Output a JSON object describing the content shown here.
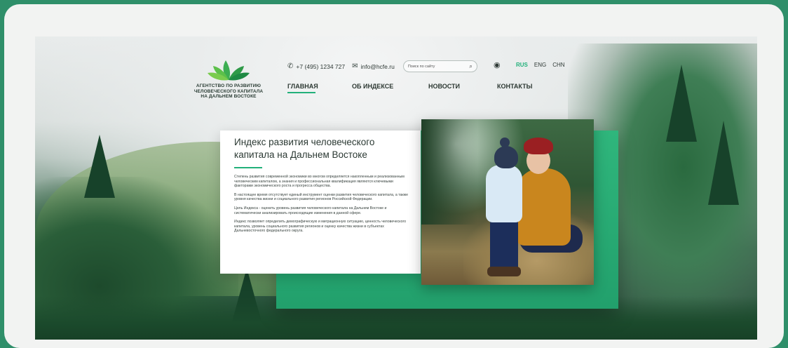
{
  "site": {
    "logo_text": "АГЕНТСТВО ПО РАЗВИТИЮ ЧЕЛОВЕЧЕСКОГО КАПИТАЛА НА ДАЛЬНЕМ ВОСТОКЕ"
  },
  "header": {
    "phone": "+7 (495) 1234 727",
    "email": "info@hcfe.ru",
    "search_placeholder": "Поиск по сайту",
    "languages": [
      "RUS",
      "ENG",
      "CHN"
    ],
    "active_language": "RUS"
  },
  "nav": {
    "items": [
      "ГЛАВНАЯ",
      "ОБ ИНДЕКСЕ",
      "НОВОСТИ",
      "КОНТАКТЫ"
    ],
    "active": "ГЛАВНАЯ"
  },
  "main": {
    "title": "Индекс развития человеческого капитала на Дальнем Востоке",
    "paragraphs": [
      "Степень развития современной экономики во многом определяется накопленным и реализованным человеческим капиталом, а знания и профессиональная квалификация являются ключевыми факторами экономического роста и прогресса общества.",
      "В настоящее время отсутствует единый инструмент оценки развития человеческого капитала, а также уровня качества жизни и социального развития регионов Российской Федерации.",
      "Цель Индекса - оценить уровень развития человеческого капитала на Дальнем Востоке и систематически анализировать происходящие изменения в данной сфере.",
      "Индекс позволяет определить демографическую и миграционную ситуацию, ценность человеческого капитала, уровень социального развития регионов и оценку качества жизни в субъектах Дальневосточного федерального округа."
    ]
  },
  "colors": {
    "accent": "#22b07a",
    "frame": "#2f8f6a"
  }
}
